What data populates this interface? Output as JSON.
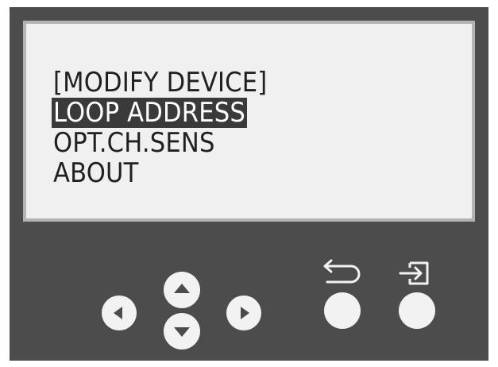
{
  "menu": {
    "items": [
      {
        "label": "[MODIFY DEVICE]",
        "selected": false
      },
      {
        "label": "LOOP ADDRESS",
        "selected": true
      },
      {
        "label": "OPT.CH.SENS",
        "selected": false
      },
      {
        "label": "ABOUT",
        "selected": false
      }
    ]
  },
  "buttons": {
    "left": "left-arrow-icon",
    "up": "up-arrow-icon",
    "down": "down-arrow-icon",
    "right": "right-arrow-icon",
    "back": "back-arrow-icon",
    "enter": "enter-icon"
  },
  "colors": {
    "bezel": "#4c4c4c",
    "screen": "#f0f0f0",
    "highlight": "#3a3a3a",
    "button": "#f2f2f2"
  }
}
